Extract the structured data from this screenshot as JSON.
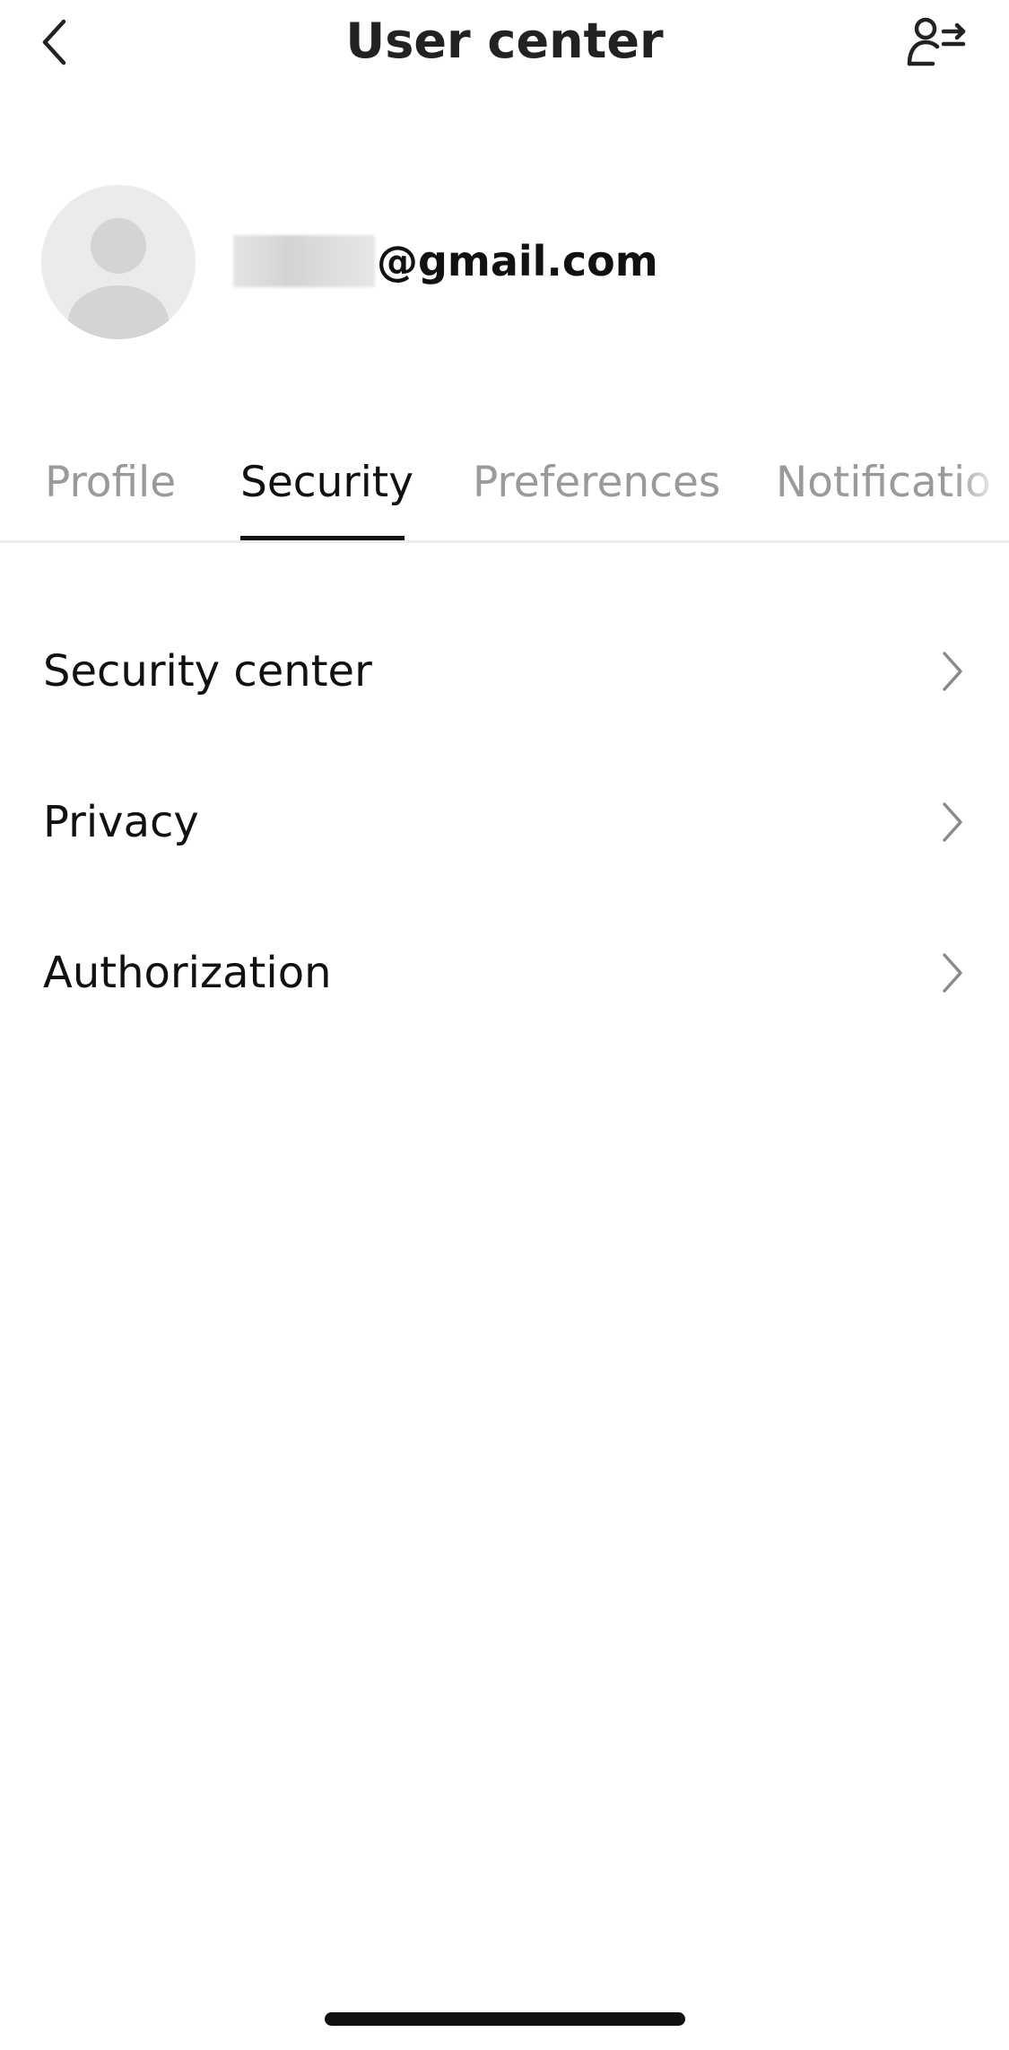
{
  "header": {
    "title": "User center",
    "back_icon": "chevron-left-icon",
    "switch_account_icon": "user-switch-icon"
  },
  "account": {
    "avatar_icon": "default-avatar-icon",
    "email_domain": "@gmail.com",
    "email_local_part_obscured": true
  },
  "tabs": {
    "active_index": 1,
    "items": [
      {
        "label": "Profile",
        "active": false
      },
      {
        "label": "Security",
        "active": true
      },
      {
        "label": "Preferences",
        "active": false
      },
      {
        "label": "Notificatio",
        "active": false
      }
    ]
  },
  "menu": {
    "items": [
      {
        "label": "Security center",
        "icon": "chevron-right-icon"
      },
      {
        "label": "Privacy",
        "icon": "chevron-right-icon"
      },
      {
        "label": "Authorization",
        "icon": "chevron-right-icon"
      }
    ]
  },
  "colors": {
    "background": "#ffffff",
    "text_primary": "#111111",
    "tab_inactive": "#9a9a9a",
    "avatar_bg": "#ebebeb",
    "avatar_fg": "#d4d4d4",
    "divider": "#ececec",
    "chevron": "#8a8a8a"
  }
}
